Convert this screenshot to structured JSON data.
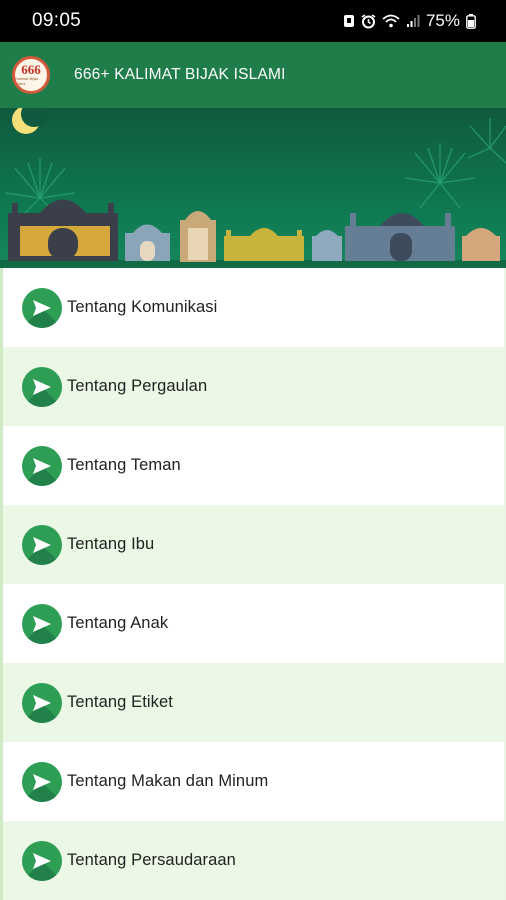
{
  "status_bar": {
    "time": "09:05",
    "battery_percent": "75%",
    "icons": [
      "notification-icon",
      "alarm-icon",
      "wifi-icon",
      "signal-icon",
      "battery-icon"
    ]
  },
  "app_bar": {
    "title": "666+ KALIMAT BIJAK ISLAMI",
    "logo_text": "666",
    "logo_subtext": "Kalimat Bijak Islami",
    "color": "#1f7d4a"
  },
  "menu": {
    "items": [
      {
        "label": "Tentang Komunikasi",
        "icon": "send-icon"
      },
      {
        "label": "Tentang Pergaulan",
        "icon": "send-icon"
      },
      {
        "label": "Tentang Teman",
        "icon": "send-icon"
      },
      {
        "label": "Tentang Ibu",
        "icon": "send-icon"
      },
      {
        "label": "Tentang Anak",
        "icon": "send-icon"
      },
      {
        "label": "Tentang Etiket",
        "icon": "send-icon"
      },
      {
        "label": "Tentang Makan dan Minum",
        "icon": "send-icon"
      },
      {
        "label": "Tentang Persaudaraan",
        "icon": "send-icon"
      }
    ],
    "badge_color": "#2e9e55",
    "alt_row_color": "#ecf8e6"
  }
}
